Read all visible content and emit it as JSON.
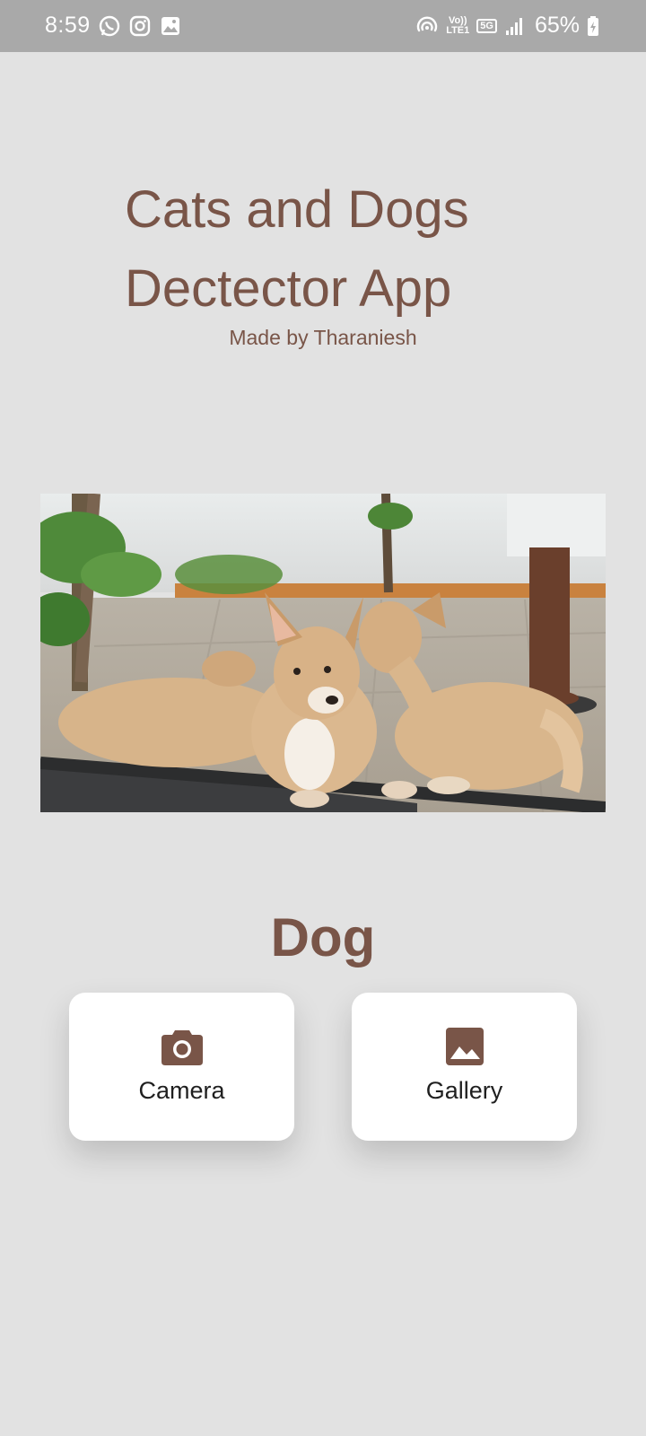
{
  "status_bar": {
    "time": "8:59",
    "left_icons": [
      "whatsapp-icon",
      "instagram-icon",
      "image-icon"
    ],
    "right_icons": [
      "hotspot-icon",
      "signal-bars-icon",
      "battery-icon"
    ],
    "volte_top": "Vo))",
    "volte_bottom": "LTE1",
    "network": "5G",
    "battery": "65%"
  },
  "header": {
    "title": "Cats and Dogs Dectector App",
    "subtitle": "Made by Tharaniesh"
  },
  "result": {
    "label": "Dog"
  },
  "actions": {
    "camera_label": "Camera",
    "gallery_label": "Gallery"
  },
  "colors": {
    "accent": "#795548",
    "background": "#e2e2e2",
    "status_bar": "#a9a9a9",
    "card": "#ffffff"
  }
}
